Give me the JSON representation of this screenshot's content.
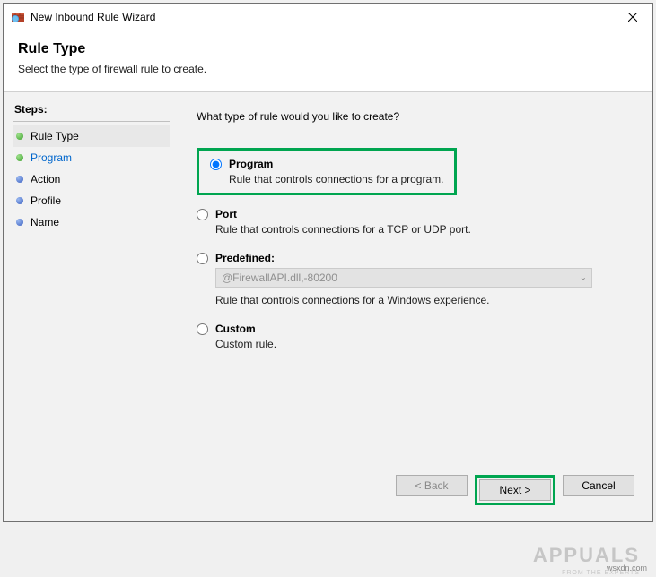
{
  "window": {
    "title": "New Inbound Rule Wizard"
  },
  "header": {
    "title": "Rule Type",
    "subtitle": "Select the type of firewall rule to create."
  },
  "sidebar": {
    "heading": "Steps:",
    "items": [
      {
        "label": "Rule Type",
        "bullet": "green",
        "active": true,
        "link": false
      },
      {
        "label": "Program",
        "bullet": "green",
        "active": false,
        "link": true
      },
      {
        "label": "Action",
        "bullet": "blue",
        "active": false,
        "link": false
      },
      {
        "label": "Profile",
        "bullet": "blue",
        "active": false,
        "link": false
      },
      {
        "label": "Name",
        "bullet": "blue",
        "active": false,
        "link": false
      }
    ]
  },
  "content": {
    "question": "What type of rule would you like to create?",
    "options": {
      "program": {
        "label": "Program",
        "desc": "Rule that controls connections for a program.",
        "selected": true
      },
      "port": {
        "label": "Port",
        "desc": "Rule that controls connections for a TCP or UDP port.",
        "selected": false
      },
      "predefined": {
        "label": "Predefined:",
        "dropdown_value": "@FirewallAPI.dll,-80200",
        "desc": "Rule that controls connections for a Windows experience.",
        "selected": false
      },
      "custom": {
        "label": "Custom",
        "desc": "Custom rule.",
        "selected": false
      }
    }
  },
  "buttons": {
    "back": "< Back",
    "next": "Next >",
    "cancel": "Cancel"
  },
  "watermark": {
    "site": "wsxdn.com",
    "logo": "APPUALS",
    "tagline": "FROM THE EXPERTS"
  }
}
